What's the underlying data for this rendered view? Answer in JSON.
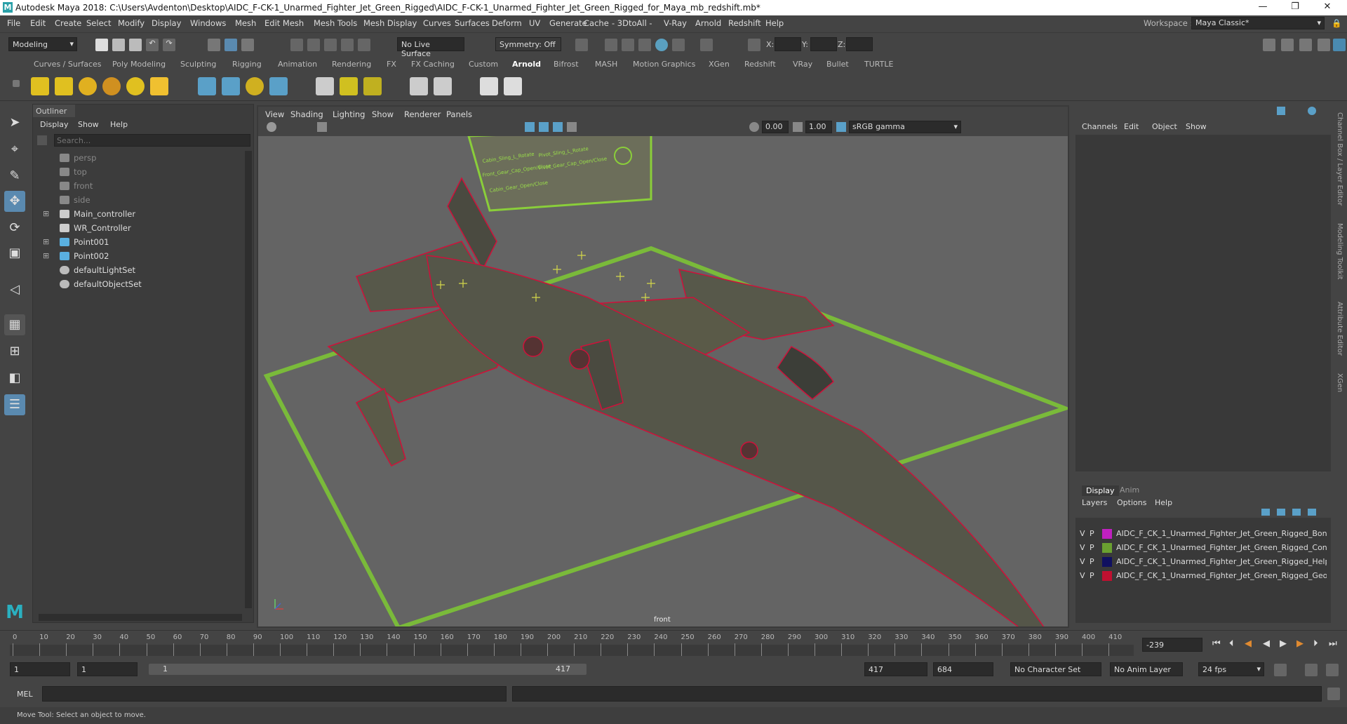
{
  "titlebar": {
    "title": "Autodesk Maya 2018: C:\\Users\\Avdenton\\Desktop\\AIDC_F-CK-1_Unarmed_Fighter_Jet_Green_Rigged\\AIDC_F-CK-1_Unarmed_Fighter_Jet_Green_Rigged_for_Maya_mb_redshift.mb*",
    "logo": "M"
  },
  "menu": [
    "File",
    "Edit",
    "Create",
    "Select",
    "Modify",
    "Display",
    "Windows",
    "Mesh",
    "Edit Mesh",
    "Mesh Tools",
    "Mesh Display",
    "Curves",
    "Surfaces",
    "Deform",
    "UV",
    "Generate",
    "Cache",
    "- 3DtoAll -",
    "V-Ray",
    "Arnold",
    "Redshift",
    "Help"
  ],
  "workspace": {
    "label": "Workspace :",
    "value": "Maya Classic*"
  },
  "statusline": {
    "mode": "Modeling",
    "live_surface": "No Live Surface",
    "symmetry": "Symmetry: Off",
    "x_label": "X:",
    "y_label": "Y:",
    "z_label": "Z:"
  },
  "shelf_tabs": [
    "Curves / Surfaces",
    "Poly Modeling",
    "Sculpting",
    "Rigging",
    "Animation",
    "Rendering",
    "FX",
    "FX Caching",
    "Custom",
    "Arnold",
    "Bifrost",
    "MASH",
    "Motion Graphics",
    "XGen",
    "Redshift",
    "VRay",
    "Bullet",
    "TURTLE"
  ],
  "active_shelf": "Arnold",
  "outliner": {
    "title": "Outliner",
    "menu": [
      "Display",
      "Show",
      "Help"
    ],
    "search_placeholder": "Search...",
    "items": [
      {
        "label": "persp",
        "dim": true,
        "icon": "camera-icon",
        "expand": false
      },
      {
        "label": "top",
        "dim": true,
        "icon": "camera-icon",
        "expand": false
      },
      {
        "label": "front",
        "dim": true,
        "icon": "camera-icon",
        "expand": false
      },
      {
        "label": "side",
        "dim": true,
        "icon": "camera-icon",
        "expand": false
      },
      {
        "label": "Main_controller",
        "dim": false,
        "icon": "transform-icon",
        "expand": true
      },
      {
        "label": "WR_Controller",
        "dim": false,
        "icon": "transform-icon",
        "expand": false
      },
      {
        "label": "Point001",
        "dim": false,
        "icon": "locator-icon",
        "expand": true
      },
      {
        "label": "Point002",
        "dim": false,
        "icon": "locator-icon",
        "expand": true
      },
      {
        "label": "defaultLightSet",
        "dim": false,
        "icon": "set-icon",
        "expand": false
      },
      {
        "label": "defaultObjectSet",
        "dim": false,
        "icon": "set-icon",
        "expand": false
      }
    ]
  },
  "viewport": {
    "menu": [
      "View",
      "Shading",
      "Lighting",
      "Show",
      "Renderer",
      "Panels"
    ],
    "exposure": "0.00",
    "gamma": "1.00",
    "colorspace": "sRGB gamma",
    "camera_label": "front",
    "hud_labels": [
      "Cabin_Sling_L_Rotate",
      "Pivot_Sling_L_Rotate",
      "Pivot_Sling_R_Rotate",
      "Cabin_Sling_R_Rotate",
      "Front_Gear_Cap_Open/Close",
      "Pivot_Gear_Cap_Open/Close",
      "Cabin_Gear_Open/Close"
    ]
  },
  "channelbox": {
    "menu": [
      "Channels",
      "Edit",
      "Object",
      "Show"
    ]
  },
  "layer_editor": {
    "tabs": [
      "Display",
      "Anim"
    ],
    "menu": [
      "Layers",
      "Options",
      "Help"
    ],
    "layers": [
      {
        "v": "V",
        "p": "P",
        "name": "AIDC_F_CK_1_Unarmed_Fighter_Jet_Green_Rigged_Bones",
        "color": "#c020c0"
      },
      {
        "v": "V",
        "p": "P",
        "name": "AIDC_F_CK_1_Unarmed_Fighter_Jet_Green_Rigged_Controllers",
        "color": "#6aa030"
      },
      {
        "v": "V",
        "p": "P",
        "name": "AIDC_F_CK_1_Unarmed_Fighter_Jet_Green_Rigged_Helpers",
        "color": "#101060"
      },
      {
        "v": "V",
        "p": "P",
        "name": "AIDC_F_CK_1_Unarmed_Fighter_Jet_Green_Rigged_Geometry",
        "color": "#c01030"
      }
    ]
  },
  "side_tabs": [
    "Channel Box / Layer Editor",
    "Modeling Toolkit",
    "Attribute Editor",
    "XGen"
  ],
  "timeline": {
    "ticks": [
      "0",
      "10",
      "20",
      "30",
      "40",
      "50",
      "60",
      "70",
      "80",
      "90",
      "100",
      "110",
      "120",
      "130",
      "140",
      "150",
      "160",
      "170",
      "180",
      "190",
      "200",
      "210",
      "220",
      "230",
      "240",
      "250",
      "260",
      "270",
      "280",
      "290",
      "300",
      "310",
      "320",
      "330",
      "340",
      "350",
      "360",
      "370",
      "380",
      "390",
      "400",
      "410"
    ],
    "current_frame": "-239"
  },
  "range": {
    "start": "1",
    "start2": "1",
    "slider_start": "1",
    "slider_end": "417",
    "end": "417",
    "end2": "684",
    "character_set": "No Character Set",
    "anim_layer": "No Anim Layer",
    "fps": "24 fps"
  },
  "mel": {
    "label": "MEL"
  },
  "help_text": "Move Tool: Select an object to move."
}
